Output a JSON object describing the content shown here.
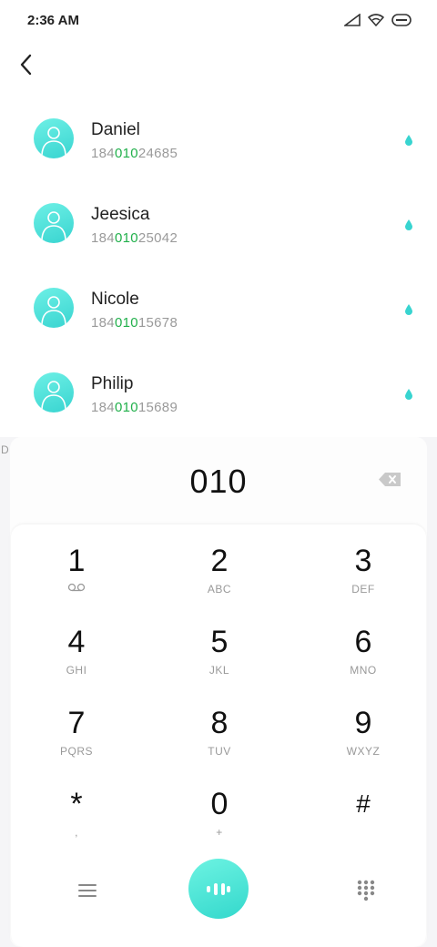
{
  "status_bar": {
    "time": "2:36 AM"
  },
  "contacts": [
    {
      "name": "Daniel",
      "number_prefix": "184",
      "number_match": "010",
      "number_suffix": "24685"
    },
    {
      "name": "Jeesica",
      "number_prefix": "184",
      "number_match": "010",
      "number_suffix": "25042"
    },
    {
      "name": "Nicole",
      "number_prefix": "184",
      "number_match": "010",
      "number_suffix": "15678"
    },
    {
      "name": "Philip",
      "number_prefix": "184",
      "number_match": "010",
      "number_suffix": "15689"
    }
  ],
  "side_index_letter": "D",
  "dialer": {
    "typed_digits": "010",
    "keys": [
      {
        "num": "1",
        "sub": ""
      },
      {
        "num": "2",
        "sub": "ABC"
      },
      {
        "num": "3",
        "sub": "DEF"
      },
      {
        "num": "4",
        "sub": "GHI"
      },
      {
        "num": "5",
        "sub": "JKL"
      },
      {
        "num": "6",
        "sub": "MNO"
      },
      {
        "num": "7",
        "sub": "PQRS"
      },
      {
        "num": "8",
        "sub": "TUV"
      },
      {
        "num": "9",
        "sub": "WXYZ"
      },
      {
        "num": "*",
        "sub": ","
      },
      {
        "num": "0",
        "sub": "+"
      },
      {
        "num": "#",
        "sub": ""
      }
    ]
  },
  "colors": {
    "accent": "#38d4d0",
    "match_highlight": "#21b04b"
  },
  "icons": {
    "back": "chevron-left-icon",
    "voicemail": "voicemail-icon",
    "backspace": "backspace-icon",
    "menu": "menu-icon",
    "call": "call-icon",
    "dialpad": "dialpad-icon",
    "contact_drop": "drop-icon"
  }
}
